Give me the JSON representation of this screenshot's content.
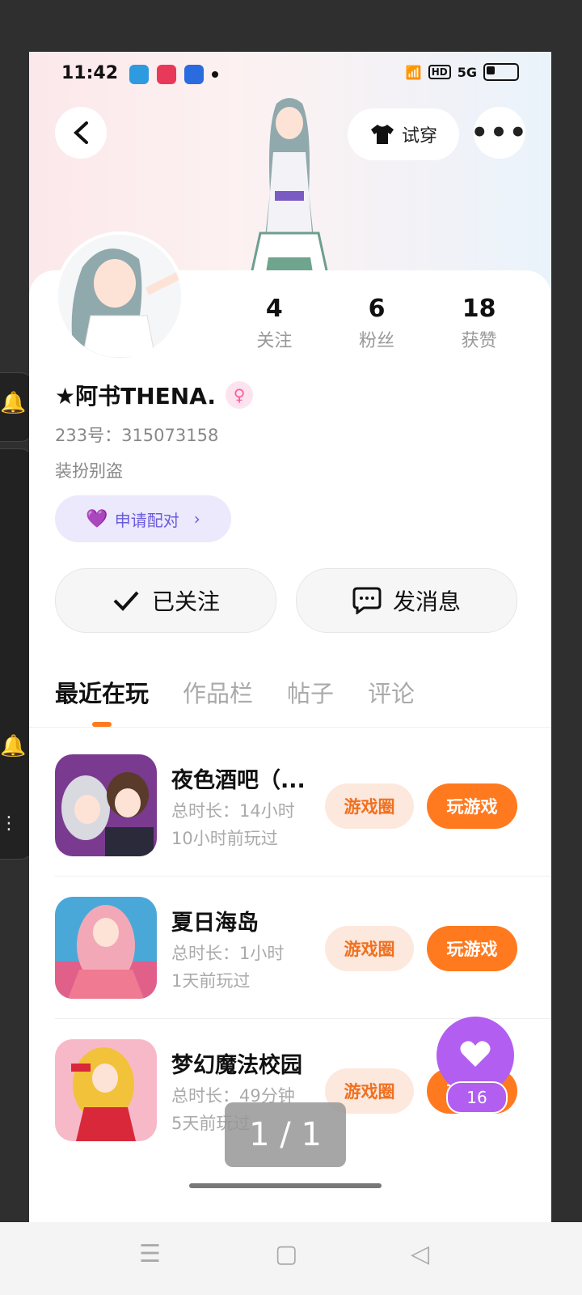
{
  "status": {
    "time": "11:42",
    "network": "5G"
  },
  "header": {
    "try_label": "试穿",
    "back_icon": "chevron-left-icon",
    "more_icon": "more-dots-icon"
  },
  "profile": {
    "stats": [
      {
        "value": "4",
        "label": "关注"
      },
      {
        "value": "6",
        "label": "粉丝"
      },
      {
        "value": "18",
        "label": "获赞"
      }
    ],
    "name": "★阿书THENA.",
    "uid": "233号：315073158",
    "bio": "装扮别盗",
    "pair_label": "申请配对"
  },
  "actions": {
    "follow_label": "已关注",
    "message_label": "发消息"
  },
  "tabs": [
    {
      "label": "最近在玩",
      "active": true
    },
    {
      "label": "作品栏",
      "active": false
    },
    {
      "label": "帖子",
      "active": false
    },
    {
      "label": "评论",
      "active": false
    }
  ],
  "games": [
    {
      "title": "夜色酒吧（...",
      "duration": "总时长：14小时",
      "last_played": "10小时前玩过",
      "circle_label": "游戏圈",
      "play_label": "玩游戏"
    },
    {
      "title": "夏日海岛",
      "duration": "总时长：1小时",
      "last_played": "1天前玩过",
      "circle_label": "游戏圈",
      "play_label": "玩游戏"
    },
    {
      "title": "梦幻魔法校园",
      "duration": "总时长：49分钟",
      "last_played": "5天前玩过",
      "circle_label": "游戏圈",
      "play_label": "玩游戏"
    }
  ],
  "like": {
    "count": "16"
  },
  "pager": {
    "text": "1 / 1"
  },
  "colors": {
    "accent": "#ff7a1f",
    "like": "#b25ef1",
    "pair": "#6a5adf"
  }
}
